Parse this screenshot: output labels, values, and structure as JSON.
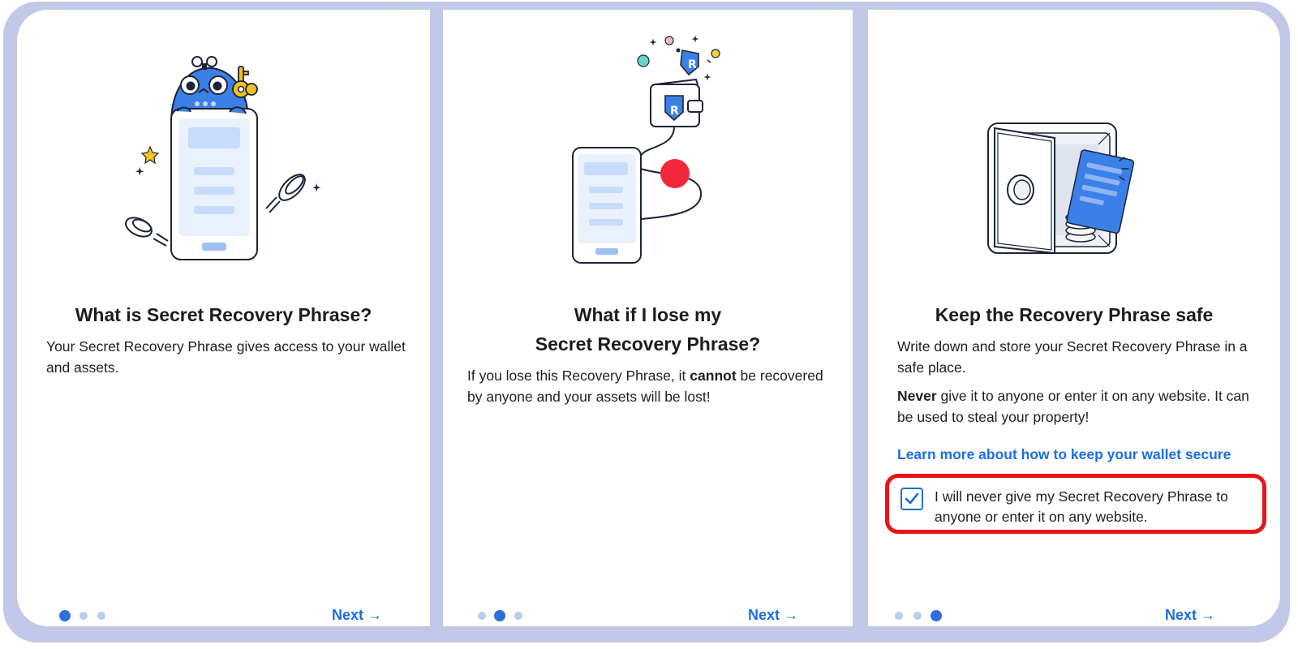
{
  "colors": {
    "frame": "#c1c8e8",
    "accent": "#1a6fe0",
    "dot_active": "#2f6fdb",
    "dot_inactive": "#b6cdf2",
    "highlight": "#e8141a"
  },
  "slides": [
    {
      "illustration": "whale-phone-key-illustration",
      "title": "What is Secret Recovery Phrase?",
      "body": "Your Secret Recovery Phrase gives access to your wallet and assets.",
      "next_label": "Next →",
      "step": 1,
      "total_steps": 3
    },
    {
      "illustration": "phone-wallet-illustration",
      "title_line1": "What if I lose my",
      "title_line2": "Secret Recovery Phrase?",
      "body_before": "If you lose this Recovery Phrase, it ",
      "body_bold": "cannot",
      "body_after": " be recovered by anyone and your assets will be lost!",
      "next_label": "Next →",
      "step": 2,
      "total_steps": 3
    },
    {
      "illustration": "safe-illustration",
      "title": "Keep the Recovery Phrase safe",
      "body1": "Write down and store your Secret Recovery Phrase in a safe place.",
      "body2_bold": "Never",
      "body2_rest": " give it to anyone or enter it on any website. It can be used to steal your property!",
      "link": "Learn more about how to keep your wallet secure",
      "confirm_text": "I will never give my Secret Recovery Phrase to anyone or enter it on any website.",
      "confirm_checked": true,
      "next_label": "Next →",
      "step": 3,
      "total_steps": 3
    }
  ]
}
